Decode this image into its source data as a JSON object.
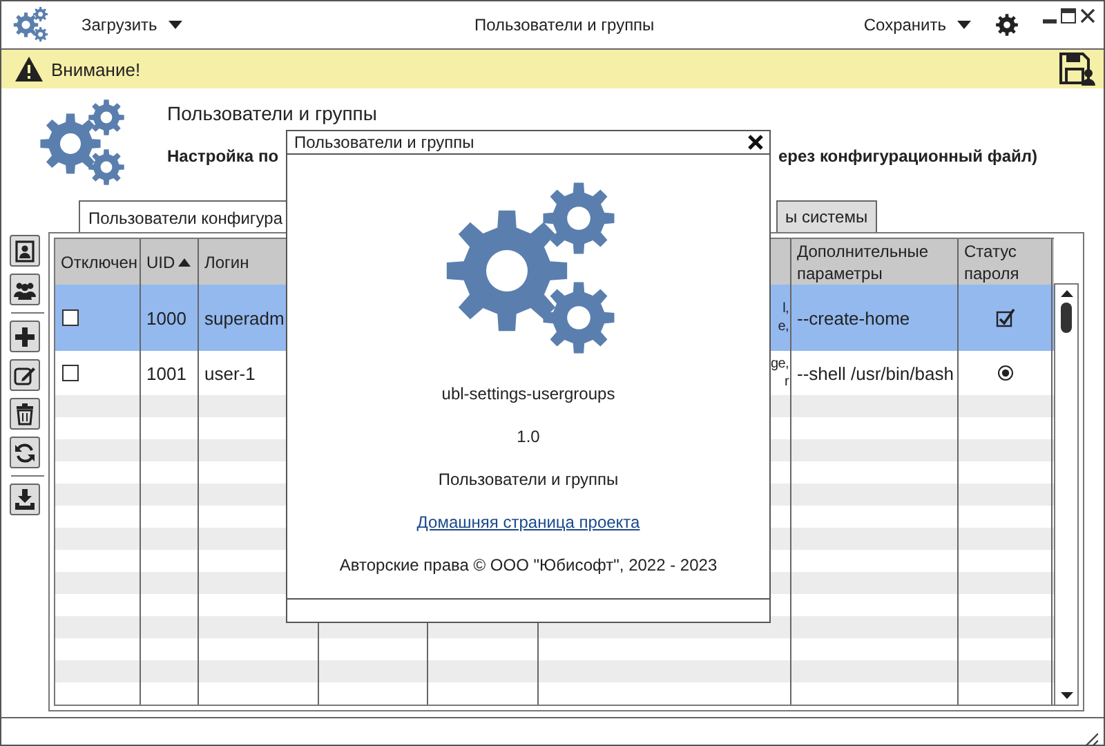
{
  "window": {
    "title": "Пользователи и группы",
    "load_menu": "Загрузить",
    "save_menu": "Сохранить"
  },
  "warning": {
    "text": "Внимание!"
  },
  "header": {
    "title": "Пользователи и группы",
    "subtitle_parts": [
      "Настройка по",
      "ерез конфигурационный файл)"
    ]
  },
  "tabs": [
    {
      "label": "Пользователи конфигура",
      "selected": true
    },
    {
      "label": "ы системы",
      "selected": false
    }
  ],
  "table": {
    "columns": [
      {
        "label": "Отключен"
      },
      {
        "label": "UID",
        "sorted": true
      },
      {
        "label": "Логин"
      },
      {
        "label": "Дополнительные параметры"
      },
      {
        "label": "Статус пароля"
      }
    ],
    "rows": [
      {
        "selected": true,
        "disabled": false,
        "uid": "1000",
        "login": "superadm",
        "column_6": [
          "l,",
          "e,"
        ],
        "extra_params": "--create-home",
        "password_status": {
          "kind": "checkbox"
        }
      },
      {
        "selected": false,
        "disabled": false,
        "uid": "1001",
        "login": "user-1",
        "column_6": [
          "ge,",
          "r"
        ],
        "extra_params": "--shell /usr/bin/bash",
        "password_status": {
          "kind": "radio"
        }
      }
    ]
  },
  "dialog": {
    "title": "Пользователи и группы",
    "app_id": "ubl-settings-usergroups",
    "version": "1.0",
    "app_name": "Пользователи и группы",
    "link": "Домашняя страница проекта",
    "copyright": "Авторские права © ООО \"Юбисофт\", 2022 - 2023"
  }
}
